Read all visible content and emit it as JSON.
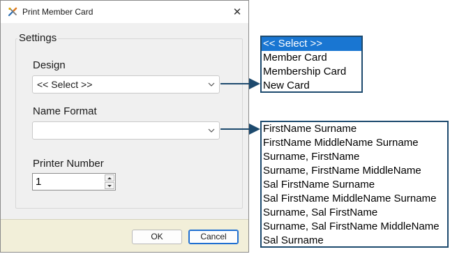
{
  "window": {
    "title": "Print Member Card",
    "close_glyph": "✕"
  },
  "settings": {
    "group_label": "Settings",
    "design_label": "Design",
    "design_value": "<< Select >>",
    "name_format_label": "Name Format",
    "name_format_value": "",
    "printer_number_label": "Printer Number",
    "printer_number_value": "1"
  },
  "buttons": {
    "ok": "OK",
    "cancel": "Cancel"
  },
  "design_options": {
    "items": [
      "<< Select >>",
      "Member Card",
      "Membership Card",
      "New Card"
    ],
    "selected_index": 0
  },
  "name_format_options": {
    "items": [
      "FirstName Surname",
      "FirstName MiddleName Surname",
      "Surname, FirstName",
      "Surname, FirstName MiddleName",
      "Sal FirstName Surname",
      "Sal FirstName MiddleName Surname",
      "Surname, Sal FirstName",
      "Surname, Sal FirstName MiddleName",
      "Sal Surname"
    ]
  },
  "colors": {
    "callout_border": "#1d4a6e",
    "selection": "#1976d2",
    "button_bar": "#f2efd9"
  }
}
